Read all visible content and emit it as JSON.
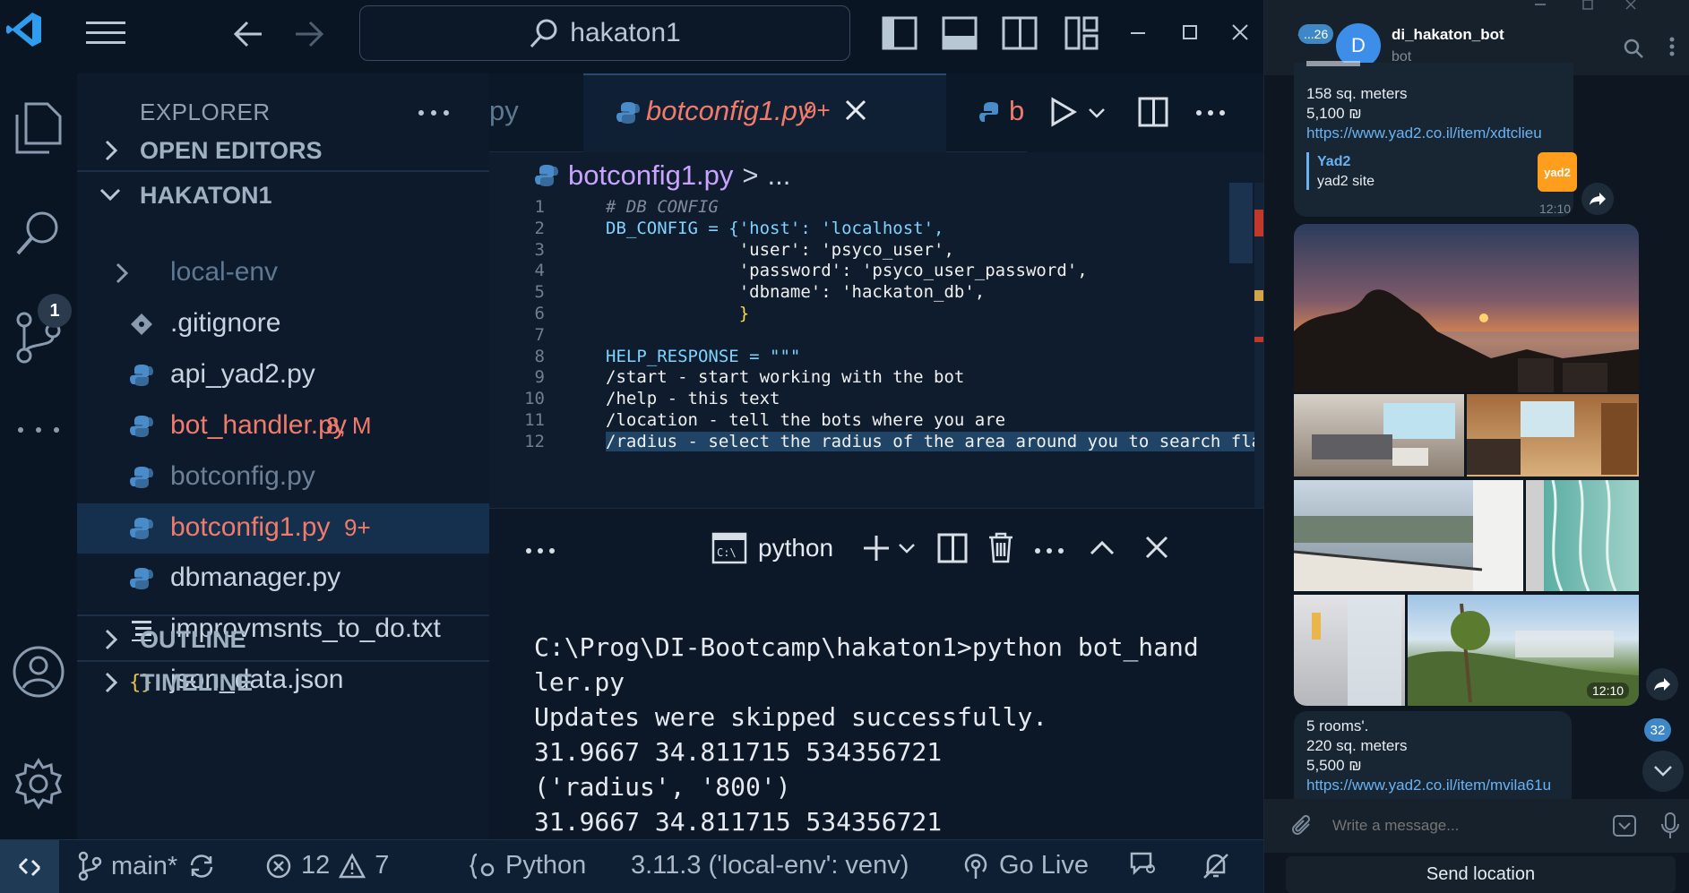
{
  "vscode": {
    "search": {
      "text": "hakaton1"
    },
    "explorer": {
      "title": "EXPLORER",
      "open_editors": "OPEN EDITORS",
      "project": "HAKATON1",
      "files": [
        {
          "name": "local-env",
          "type": "folder",
          "color": "#5f7892"
        },
        {
          "name": ".gitignore",
          "type": "git",
          "color": "#c8d3e0"
        },
        {
          "name": "api_yad2.py",
          "type": "python",
          "color": "#c8d3e0"
        },
        {
          "name": "bot_handler.py",
          "type": "python",
          "color": "#f07b6b",
          "badge": "8, M"
        },
        {
          "name": "botconfig.py",
          "type": "python",
          "color": "#6d8096"
        },
        {
          "name": "botconfig1.py",
          "type": "python",
          "color": "#f07b6b",
          "badge": "9+",
          "selected": true
        },
        {
          "name": "dbmanager.py",
          "type": "python",
          "color": "#c8d3e0"
        },
        {
          "name": "improvmsnts_to_do.txt",
          "type": "text",
          "color": "#c8d3e0"
        },
        {
          "name": "json_data.json",
          "type": "json",
          "color": "#c8d3e0"
        }
      ],
      "outline": "OUTLINE",
      "timeline": "TIMELINE"
    },
    "tabs": {
      "left_partial": "py",
      "active_name": "botconfig1.py",
      "active_badge": "9+",
      "right_partial": "b"
    },
    "breadcrumb": {
      "file": "botconfig1.py",
      "sep": ">",
      "rest": "..."
    },
    "code": [
      {
        "n": "1",
        "t": "# DB CONFIG"
      },
      {
        "n": "2",
        "t": "DB_CONFIG = {'host': 'localhost',"
      },
      {
        "n": "3",
        "t": "             'user': 'psyco_user',"
      },
      {
        "n": "4",
        "t": "             'password': 'psyco_user_password',"
      },
      {
        "n": "5",
        "t": "             'dbname': 'hackaton_db',"
      },
      {
        "n": "6",
        "t": "             }"
      },
      {
        "n": "7",
        "t": ""
      },
      {
        "n": "8",
        "t": "HELP_RESPONSE = \"\"\""
      },
      {
        "n": "9",
        "t": "/start - start working with the bot"
      },
      {
        "n": "10",
        "t": "/help - this text"
      },
      {
        "n": "11",
        "t": "/location - tell the bots where you are"
      },
      {
        "n": "12",
        "t": "/radius - select the radius of the area around you to search flat"
      }
    ],
    "terminal": {
      "label": "python",
      "output": "C:\\Prog\\DI-Bootcamp\\hakaton1>python bot_hand\nler.py\nUpdates were skipped successfully.\n31.9667 34.811715 534356721\n('radius', '800')\n31.9667 34.811715 534356721"
    },
    "activity": {
      "scm_badge": "1"
    },
    "status": {
      "branch": "main*",
      "errors": "12",
      "warnings": "7",
      "language": "Python",
      "interpreter": "3.11.3 ('local-env': venv)",
      "golive": "Go Live"
    }
  },
  "telegram": {
    "back_badge": "...26",
    "avatar_letter": "D",
    "chat_name": "di_hakaton_bot",
    "chat_status": "bot",
    "msg1": {
      "lines": [
        "158  sq. meters",
        "5,100 ₪"
      ],
      "link": "https://www.yad2.co.il/item/xdtclieu",
      "preview_title": "Yad2",
      "preview_desc": "yad2 site",
      "time": "12:10"
    },
    "album_time": "12:10",
    "msg2": {
      "lines": [
        "5 rooms'.",
        "220  sq. meters",
        "5,500 ₪"
      ],
      "link": "https://www.yad2.co.il/item/mvila61u"
    },
    "unread_badge": "32",
    "input_placeholder": "Write a message...",
    "send_location": "Send location"
  }
}
